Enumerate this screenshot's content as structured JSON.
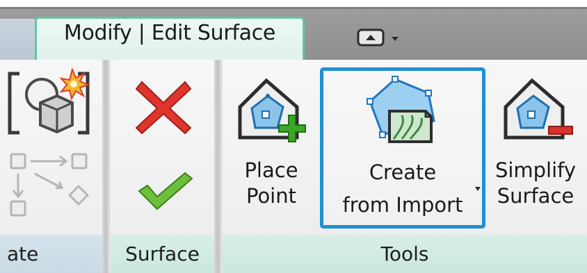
{
  "ribbon": {
    "active_tab": "Modify | Edit Surface",
    "quick_access_dropdown_icon": "panel-toggle-icon"
  },
  "panels": {
    "left": {
      "label_partial": "ate"
    },
    "surface": {
      "label": "Surface",
      "cancel_icon": "red-x-icon",
      "finish_icon": "green-check-icon"
    },
    "tools": {
      "label": "Tools",
      "place_point": {
        "line1": "Place",
        "line2": "Point"
      },
      "create_from_import": {
        "line1": "Create",
        "line2": "from Import"
      },
      "simplify_surface": {
        "line1": "Simplify",
        "line2": "Surface"
      }
    }
  },
  "colors": {
    "active_tab_border": "#63c7a3",
    "highlight_border": "#1f8fd6",
    "cancel_red": "#e0352c",
    "finish_green": "#4ea524"
  }
}
